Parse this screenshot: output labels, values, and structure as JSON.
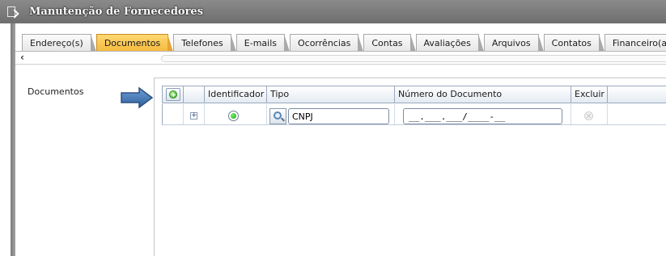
{
  "window": {
    "title": "Manutenção de Fornecedores"
  },
  "tabs": [
    {
      "label": "Endereço(s)",
      "active": false
    },
    {
      "label": "Documentos",
      "active": true
    },
    {
      "label": "Telefones",
      "active": false
    },
    {
      "label": "E-mails",
      "active": false
    },
    {
      "label": "Ocorrências",
      "active": false
    },
    {
      "label": "Contas",
      "active": false
    },
    {
      "label": "Avaliações",
      "active": false
    },
    {
      "label": "Arquivos",
      "active": false
    },
    {
      "label": "Contatos",
      "active": false
    },
    {
      "label": "Financeiro(a)",
      "active": false
    }
  ],
  "scroll": {
    "left_arrow": "‹"
  },
  "section": {
    "label": "Documentos"
  },
  "grid": {
    "columns": [
      "Identificador",
      "Tipo",
      "Número do Documento",
      "Excluir"
    ],
    "rows": [
      {
        "expand_symbol": "+",
        "identificador_selected": true,
        "tipo": "CNPJ",
        "numero": "__.___.___/____-__"
      }
    ]
  },
  "colors": {
    "active_tab": "#f5b93a",
    "title_bar": "#7a7a7a",
    "header_border": "#9aa9bd",
    "arrow": "#3f6ea6"
  }
}
